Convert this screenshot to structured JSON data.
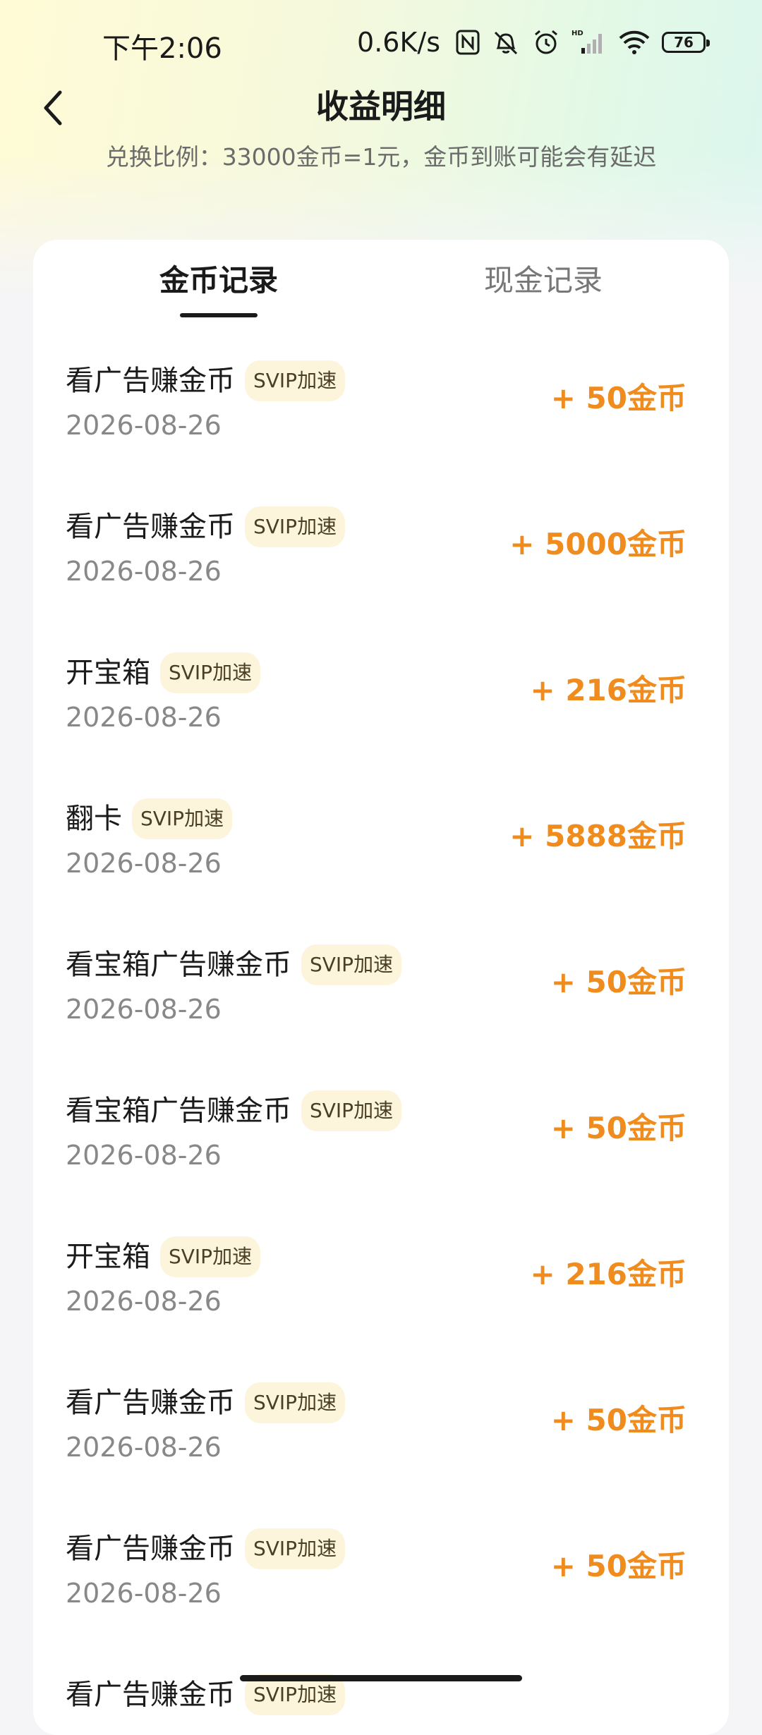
{
  "status_bar": {
    "time": "下午2:06",
    "net_speed": "0.6K/s",
    "battery": "76",
    "signal_label": "HD"
  },
  "header": {
    "title": "收益明细",
    "subtitle": "兑换比例：33000金币=1元，金币到账可能会有延迟"
  },
  "tabs": [
    {
      "label": "金币记录",
      "active": true
    },
    {
      "label": "现金记录",
      "active": false
    }
  ],
  "records": [
    {
      "title": "看广告赚金币",
      "badge": "SVIP加速",
      "date": "2026-08-26",
      "amount": "+ 50金币"
    },
    {
      "title": "看广告赚金币",
      "badge": "SVIP加速",
      "date": "2026-08-26",
      "amount": "+ 5000金币"
    },
    {
      "title": "开宝箱",
      "badge": "SVIP加速",
      "date": "2026-08-26",
      "amount": "+ 216金币"
    },
    {
      "title": "翻卡",
      "badge": "SVIP加速",
      "date": "2026-08-26",
      "amount": "+ 5888金币"
    },
    {
      "title": "看宝箱广告赚金币",
      "badge": "SVIP加速",
      "date": "2026-08-26",
      "amount": "+ 50金币"
    },
    {
      "title": "看宝箱广告赚金币",
      "badge": "SVIP加速",
      "date": "2026-08-26",
      "amount": "+ 50金币"
    },
    {
      "title": "开宝箱",
      "badge": "SVIP加速",
      "date": "2026-08-26",
      "amount": "+ 216金币"
    },
    {
      "title": "看广告赚金币",
      "badge": "SVIP加速",
      "date": "2026-08-26",
      "amount": "+ 50金币"
    },
    {
      "title": "看广告赚金币",
      "badge": "SVIP加速",
      "date": "2026-08-26",
      "amount": "+ 50金币"
    },
    {
      "title": "看广告赚金币",
      "badge": "SVIP加速",
      "date": "",
      "amount": ""
    }
  ],
  "colors": {
    "accent_amount": "#f08c1d",
    "badge_bg": "#fcf5dc",
    "gradient_start": "#fffbd6",
    "gradient_end": "#dcf6ef"
  }
}
